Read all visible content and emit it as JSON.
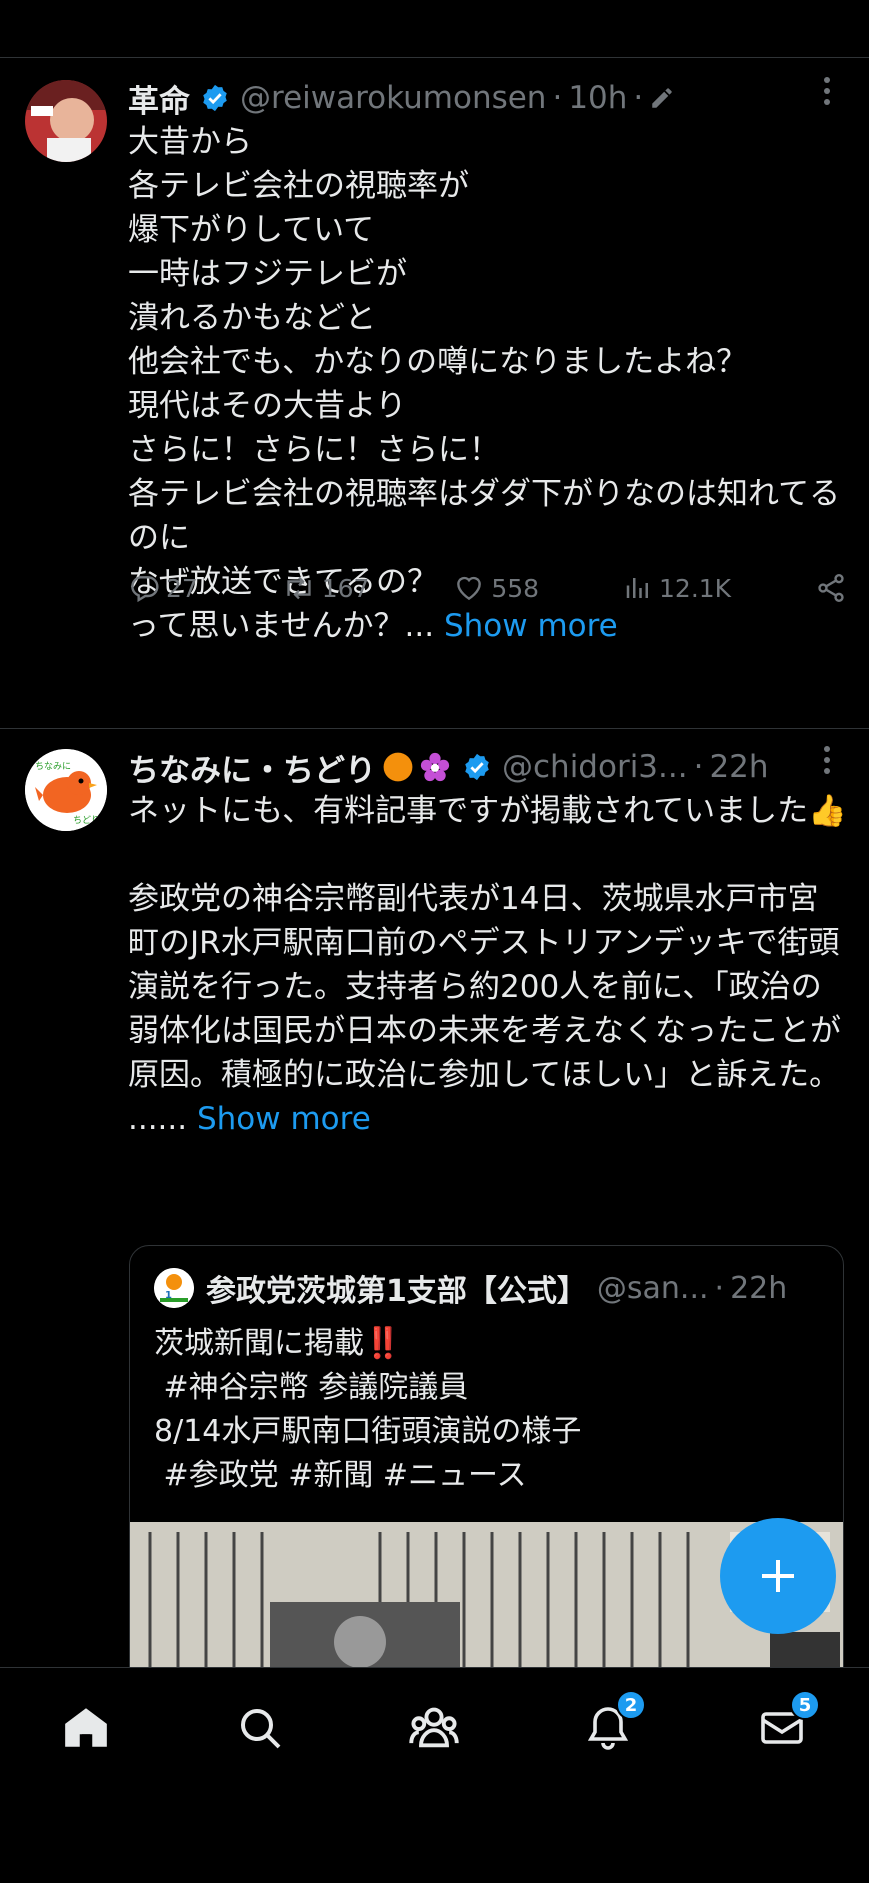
{
  "tweets": [
    {
      "name": "革命",
      "handle": "@reiwarokumonsen",
      "time": "10h",
      "text": "大昔から\n各テレビ会社の視聴率が\n爆下がりしていて\n一時はフジテレビが\n潰れるかもなどと\n他会社でも、かなりの噂になりましたよね？\n現代はその大昔より\nさらに！さらに！さらに！\n各テレビ会社の視聴率はダダ下がりなのは知れてるのに\nなぜ放送できてるの？\nって思いませんか？...",
      "show_more": "Show more",
      "replies": "27",
      "reposts": "167",
      "likes": "558",
      "views": "12.1K"
    },
    {
      "name": "ちなみに・ちどり",
      "handle": "@chidori3...",
      "time": "22h",
      "text": "ネットにも、有料記事ですが掲載されていました👍\n\n参政党の神谷宗幣副代表が14日、茨城県水戸市宮町のJR水戸駅南口前のペデストリアンデッキで街頭演説を行った。支持者ら約200人を前に、「政治の弱体化は国民が日本の未来を考えなくなったことが原因。積極的に政治に参加してほしい」と訴えた。\n......",
      "show_more": "Show more",
      "quote": {
        "name": "参政党茨城第1支部【公式】",
        "handle": "@san...",
        "time": "22h",
        "text": "茨城新聞に掲載‼️\n #神谷宗幣 参議院議員\n8/14水戸駅南口街頭演説の様子\n #参政党 #新聞 #ニュース"
      }
    }
  ],
  "nav": {
    "notifications_badge": "2",
    "messages_badge": "5"
  },
  "colors": {
    "accent": "#1d9bf0",
    "muted": "#71767b",
    "background": "#000000"
  }
}
